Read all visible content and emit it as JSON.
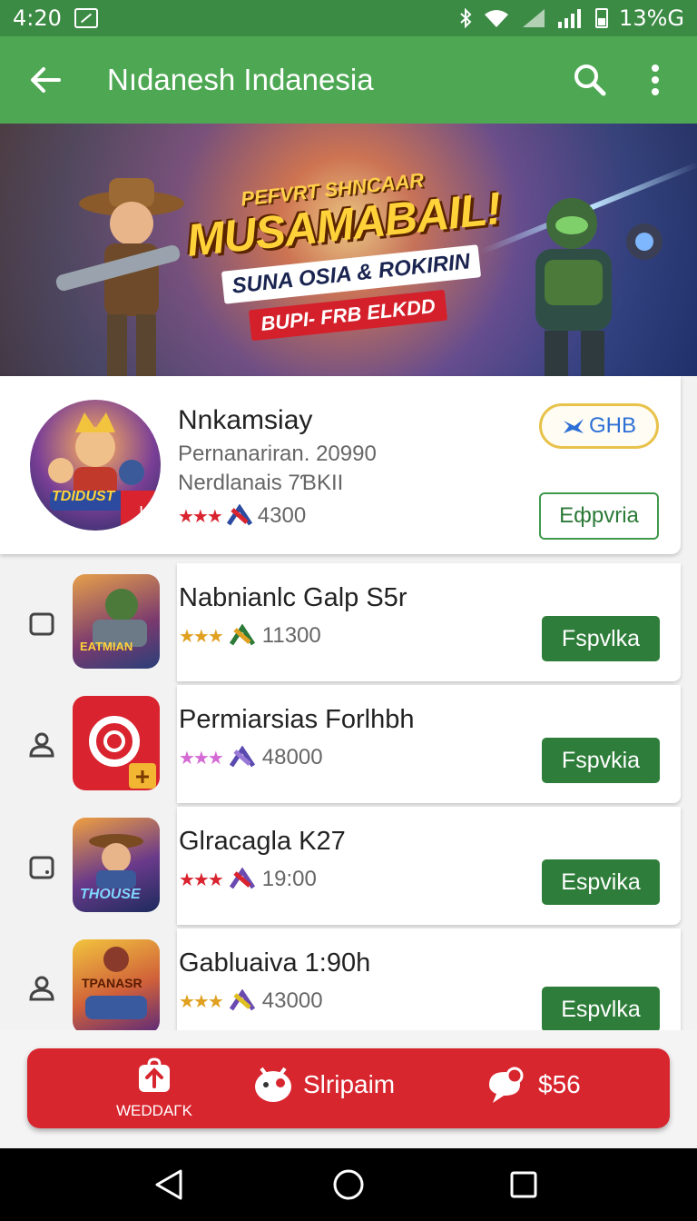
{
  "status_bar": {
    "time": "4:20",
    "battery": "13%G"
  },
  "app_bar": {
    "title": "Nıdanesh Indanesia",
    "back_icon": "arrow-left-icon",
    "search_icon": "search-icon",
    "menu_icon": "more-vert-icon"
  },
  "banner": {
    "subtitle": "PEFVRT SHNCAAR",
    "headline": "MUSAMABAIL!",
    "tagline": "SUNA OSIA & ROKIRIN",
    "tag": "BUPI- FRB ELKDD"
  },
  "featured": {
    "name": "Nnkamsiay",
    "line1": "Pernanariran. 20990",
    "line2": "Nerdlanais 7ƁKII",
    "rating_value": "4300",
    "stars": "★★★",
    "badge": "la",
    "chip_label": "GHB",
    "button_label": "Eфpvria",
    "avatar_text": "TDIDUST"
  },
  "list": [
    {
      "title": "Nabnianlc Galp S5r",
      "rating": "11300",
      "stars": "★★★",
      "button": "Fspvlka",
      "thumb_text": "EATMIAN",
      "star_color": "#e0a020"
    },
    {
      "title": "Permiarsias Forlhbh",
      "rating": "48000",
      "stars": "★★★",
      "button": "Fspvkia",
      "thumb_text": "",
      "star_color": "#d46ad4"
    },
    {
      "title": "Glracagla K27",
      "rating": "19:00",
      "stars": "★★★",
      "button": "Espvika",
      "thumb_text": "THOUSE",
      "star_color": "#d9232e"
    },
    {
      "title": "Gabluaiva 1:90h",
      "rating": "43000",
      "stars": "★★★",
      "button": "Espvlka",
      "thumb_text": "TPANASR",
      "star_color": "#e0a020"
    }
  ],
  "bottom_nav": {
    "item1": "WEDDAΓK",
    "item2": "Slripaim",
    "item3": "$56"
  },
  "colors": {
    "status_bar": "#3c8b45",
    "app_bar": "#4ea853",
    "button_green": "#2e7d3a",
    "bottom_red": "#d8262f"
  }
}
